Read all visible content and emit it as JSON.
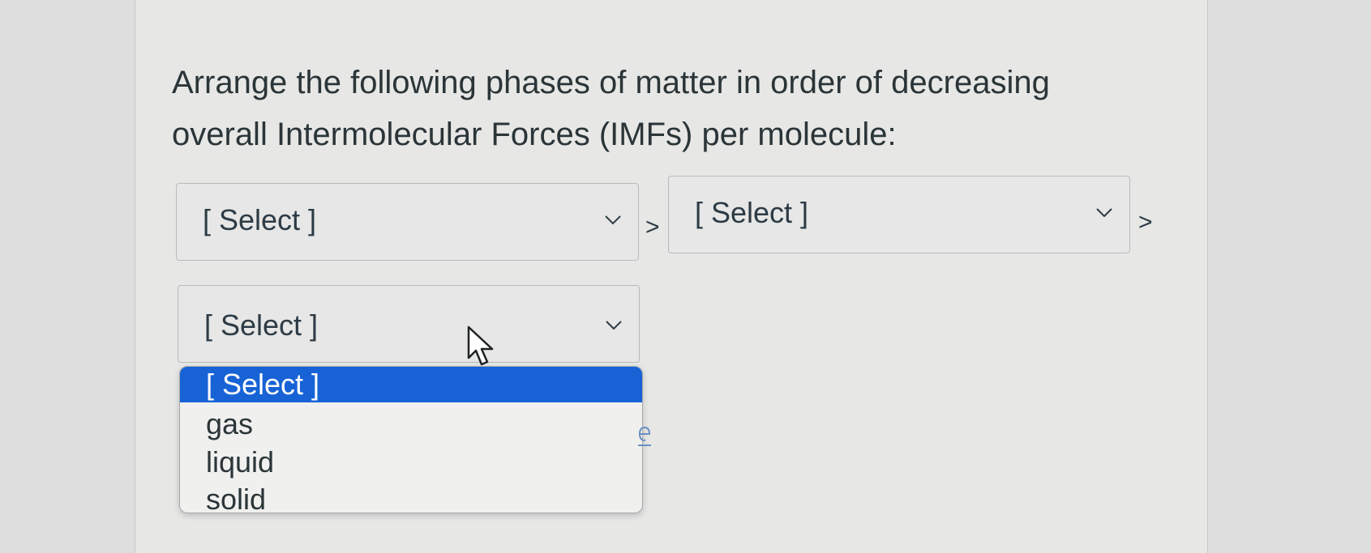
{
  "question": {
    "text": "Arrange the following phases of matter in order of decreasing overall Intermolecular Forces (IMFs) per molecule:"
  },
  "selects": [
    {
      "value": "[ Select ]"
    },
    {
      "value": "[ Select ]"
    },
    {
      "value": "[ Select ]"
    }
  ],
  "separators": [
    ">",
    ">"
  ],
  "dropdown": {
    "options": [
      {
        "label": "[ Select ]",
        "selected": true
      },
      {
        "label": "gas",
        "selected": false
      },
      {
        "label": "liquid",
        "selected": false
      },
      {
        "label": "solid",
        "selected": false
      }
    ]
  },
  "icons": {
    "chevron": "chevron-down-icon",
    "cursor": "mouse-pointer-icon"
  },
  "colors": {
    "highlight": "#1763d6",
    "panel": "#e7e7e6",
    "text": "#2d3b45"
  }
}
